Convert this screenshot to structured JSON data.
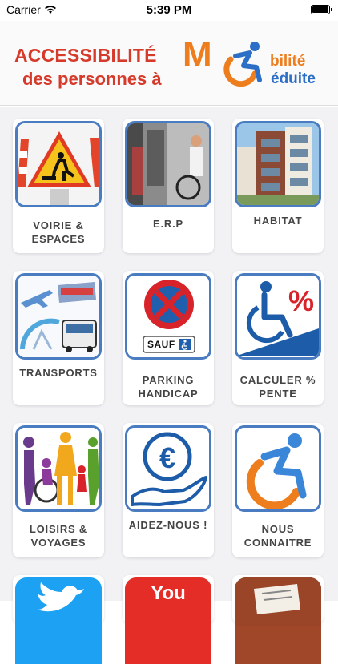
{
  "status": {
    "carrier": "Carrier",
    "time": "5:39 PM"
  },
  "header": {
    "line1": "ACCESSIBILITÉ",
    "line2": "des personnes à",
    "logo_m": "M",
    "logo_word1": "bilité",
    "logo_word2": "éduite"
  },
  "tiles": [
    {
      "label1": "VOIRIE &",
      "label2": "ESPACES"
    },
    {
      "label1": "E.R.P",
      "label2": ""
    },
    {
      "label1": "HABITAT",
      "label2": ""
    },
    {
      "label1": "TRANSPORTS",
      "label2": ""
    },
    {
      "label1": "PARKING",
      "label2": "HANDICAP",
      "sign_text": "SAUF"
    },
    {
      "label1": "CALCULER %",
      "label2": "PENTE"
    },
    {
      "label1": "LOISIRS &",
      "label2": "VOYAGES"
    },
    {
      "label1": "AIDEZ-NOUS !",
      "label2": ""
    },
    {
      "label1": "NOUS",
      "label2": "CONNAITRE"
    },
    {
      "label1": "",
      "label2": ""
    },
    {
      "label1": "",
      "label2": "",
      "partial_text": "You"
    },
    {
      "label1": "",
      "label2": ""
    }
  ],
  "colors": {
    "accent_blue": "#4a7cc2",
    "brand_red": "#d63a2b",
    "brand_orange": "#ee7d1d"
  }
}
